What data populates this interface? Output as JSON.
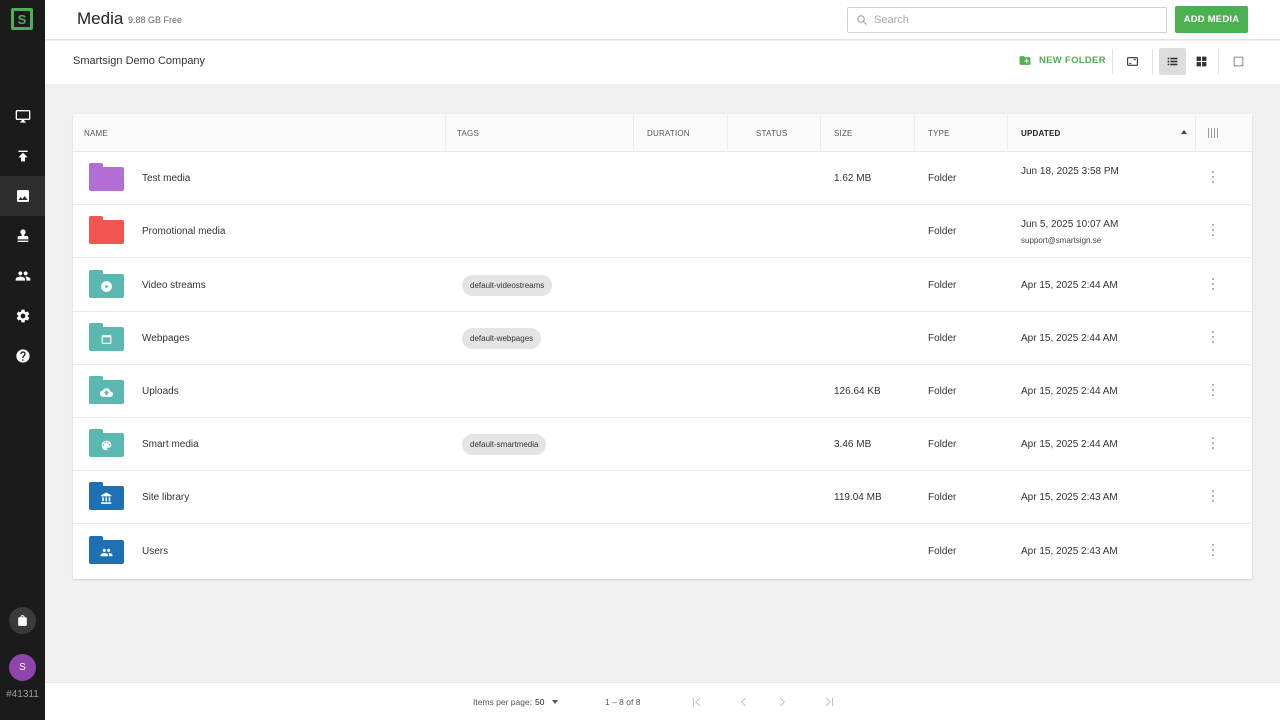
{
  "sidebar": {
    "logo_letter": "S",
    "account_id": "#41311",
    "avatar_initial": "S",
    "items": [
      {
        "name": "screens",
        "icon": "monitor-icon"
      },
      {
        "name": "publish",
        "icon": "upload-icon"
      },
      {
        "name": "media",
        "icon": "image-icon",
        "active": true
      },
      {
        "name": "stamp",
        "icon": "stamp-icon"
      },
      {
        "name": "users",
        "icon": "people-icon"
      },
      {
        "name": "settings",
        "icon": "gear-icon"
      },
      {
        "name": "help",
        "icon": "help-icon"
      }
    ]
  },
  "header": {
    "title": "Media",
    "storage": "9.88 GB Free",
    "search_placeholder": "Search",
    "add_media_label": "ADD MEDIA"
  },
  "toolbar": {
    "company": "Smartsign Demo Company",
    "new_folder_label": "NEW FOLDER"
  },
  "table": {
    "columns": [
      "NAME",
      "TAGS",
      "DURATION",
      "STATUS",
      "SIZE",
      "TYPE",
      "UPDATED"
    ],
    "sort_column": "UPDATED",
    "rows": [
      {
        "name": "Test media",
        "tag": "",
        "size": "1.62 MB",
        "type": "Folder",
        "updated": "Jun 18, 2025 3:58 PM",
        "updated_by": "",
        "color": "#b36ed6",
        "icon": "folder-icon"
      },
      {
        "name": "Promotional media",
        "tag": "",
        "size": "",
        "type": "Folder",
        "updated": "Jun 5, 2025 10:07 AM",
        "updated_by": "support@smartsign.se",
        "color": "#f0554f",
        "icon": "folder-icon"
      },
      {
        "name": "Video streams",
        "tag": "default-videostreams",
        "size": "",
        "type": "Folder",
        "updated": "Apr 15, 2025 2:44 AM",
        "updated_by": "",
        "color": "#5bb8b0",
        "icon": "play-icon"
      },
      {
        "name": "Webpages",
        "tag": "default-webpages",
        "size": "",
        "type": "Folder",
        "updated": "Apr 15, 2025 2:44 AM",
        "updated_by": "",
        "color": "#5bb8b0",
        "icon": "browser-window-icon"
      },
      {
        "name": "Uploads",
        "tag": "",
        "size": "126.64 KB",
        "type": "Folder",
        "updated": "Apr 15, 2025 2:44 AM",
        "updated_by": "",
        "color": "#5bb8b0",
        "icon": "cloud-upload-icon"
      },
      {
        "name": "Smart media",
        "tag": "default-smartmedia",
        "size": "3.46 MB",
        "type": "Folder",
        "updated": "Apr 15, 2025 2:44 AM",
        "updated_by": "",
        "color": "#5bb8b0",
        "icon": "palette-icon"
      },
      {
        "name": "Site library",
        "tag": "",
        "size": "119.04 MB",
        "type": "Folder",
        "updated": "Apr 15, 2025 2:43 AM",
        "updated_by": "",
        "color": "#1f6fb5",
        "icon": "bank-icon"
      },
      {
        "name": "Users",
        "tag": "",
        "size": "",
        "type": "Folder",
        "updated": "Apr 15, 2025 2:43 AM",
        "updated_by": "",
        "color": "#1f6fb5",
        "icon": "people-icon"
      }
    ]
  },
  "footer": {
    "items_per_page_label": "Items per page:",
    "items_per_page_value": "50",
    "range": "1 – 8 of 8"
  },
  "colors": {
    "accent": "#4caf50",
    "sidebar_bg": "#1b1b1b",
    "avatar": "#8e44ad"
  }
}
